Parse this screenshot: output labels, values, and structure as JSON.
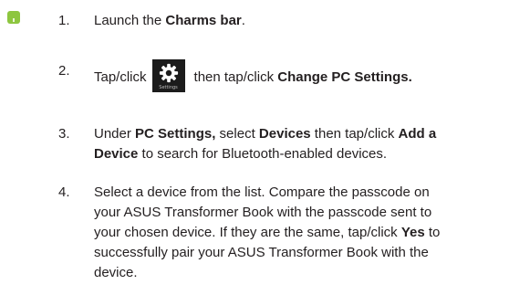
{
  "marker": {
    "color": "#8dc63f",
    "icon": "step-marker-icon"
  },
  "steps": [
    {
      "number": "1.",
      "parts": {
        "a": "Launch the ",
        "b": "Charms bar",
        "c": "."
      }
    },
    {
      "number": "2.",
      "parts": {
        "a": "Tap/click",
        "b": "then tap/click ",
        "c": "Change PC Settings."
      },
      "icon": {
        "name": "gear-icon",
        "label": "Settings"
      }
    },
    {
      "number": "3.",
      "parts": {
        "a": "Under ",
        "b": "PC Settings,",
        "c": " select ",
        "d": "Devices",
        "e": " then tap/click ",
        "f": "Add a Device",
        "g": " to search for Bluetooth-enabled devices."
      }
    },
    {
      "number": "4.",
      "parts": {
        "a": "Select a device from the list. Compare the passcode on your ASUS Transformer Book with the passcode sent to your chosen device. If they are the same, tap/click ",
        "b": "Yes",
        "c": " to successfully pair your ASUS Transformer Book with the device."
      }
    }
  ]
}
